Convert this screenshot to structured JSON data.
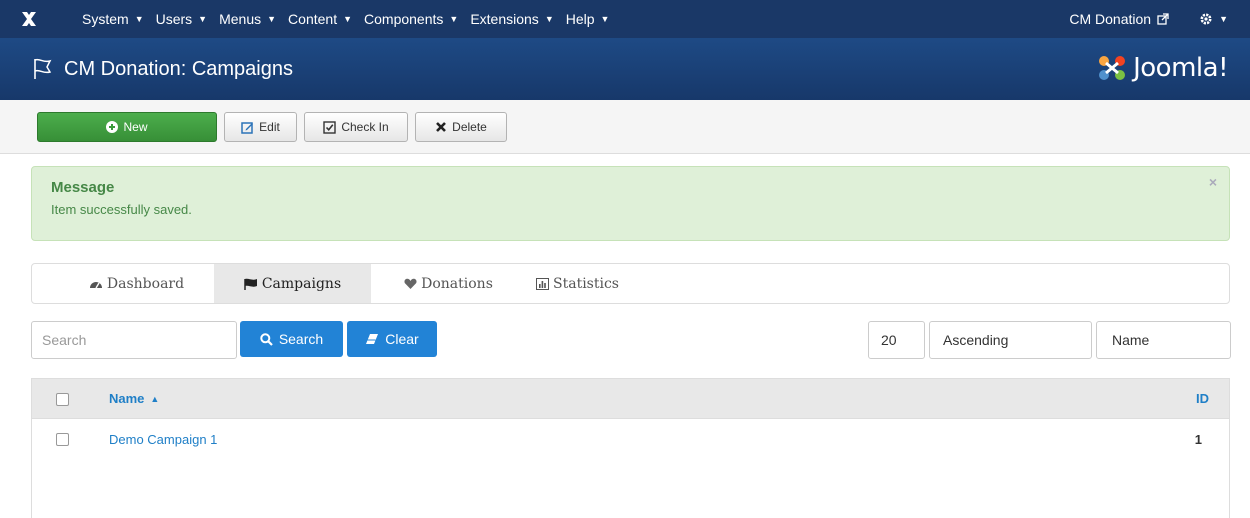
{
  "topbar": {
    "menus": [
      "System",
      "Users",
      "Menus",
      "Content",
      "Components",
      "Extensions",
      "Help"
    ],
    "site_link": "CM Donation"
  },
  "header": {
    "title": "CM Donation: Campaigns",
    "brand": "Joomla!"
  },
  "toolbar": {
    "new_label": "New",
    "edit_label": "Edit",
    "checkin_label": "Check In",
    "delete_label": "Delete"
  },
  "message": {
    "heading": "Message",
    "text": "Item successfully saved.",
    "close": "×"
  },
  "tabs": [
    {
      "label": "Dashboard",
      "icon": "dashboard-icon"
    },
    {
      "label": "Campaigns",
      "icon": "flag-icon"
    },
    {
      "label": "Donations",
      "icon": "heart-icon"
    },
    {
      "label": "Statistics",
      "icon": "bar-chart-icon"
    }
  ],
  "filters": {
    "search_placeholder": "Search",
    "search_button": "Search",
    "clear_button": "Clear",
    "limit": "20",
    "direction": "Ascending",
    "ordering": "Name"
  },
  "table": {
    "columns": {
      "name": "Name",
      "id": "ID"
    },
    "rows": [
      {
        "name": "Demo Campaign 1",
        "id": "1"
      }
    ]
  },
  "colors": {
    "navbar": "#1a3867",
    "header": "#1e4a85",
    "success": "#dff0d8",
    "primary_button": "#2283d6",
    "link": "#1f7fc7"
  }
}
